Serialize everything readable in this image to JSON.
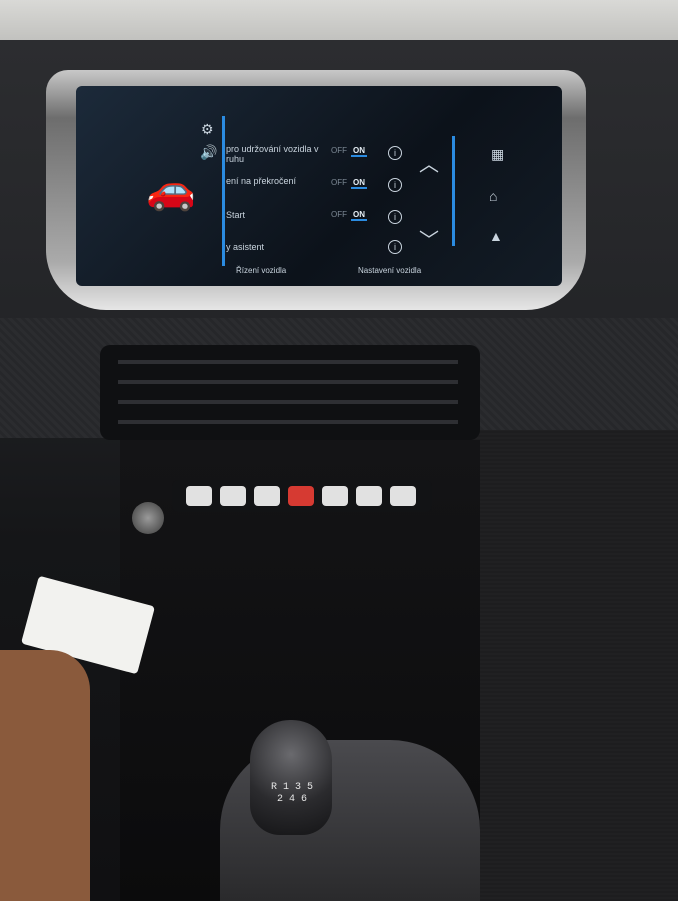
{
  "screen": {
    "rows": [
      {
        "label": "pro udržování vozidla v\nruhu",
        "has_toggle": true,
        "off": "OFF",
        "on": "ON"
      },
      {
        "label": "ení na překročení",
        "has_toggle": true,
        "off": "OFF",
        "on": "ON"
      },
      {
        "label": "Start",
        "has_toggle": true,
        "off": "OFF",
        "on": "ON"
      },
      {
        "label": "y asistent",
        "has_toggle": false
      }
    ],
    "footer_left": "Řízení vozidla",
    "footer_right": "Nastavení vozidla"
  },
  "shifter": {
    "pattern_top": "R 1 3 5",
    "pattern_bottom": "2 4 6"
  },
  "colors": {
    "accent": "#2b8be0",
    "hazard": "#d63a32"
  }
}
